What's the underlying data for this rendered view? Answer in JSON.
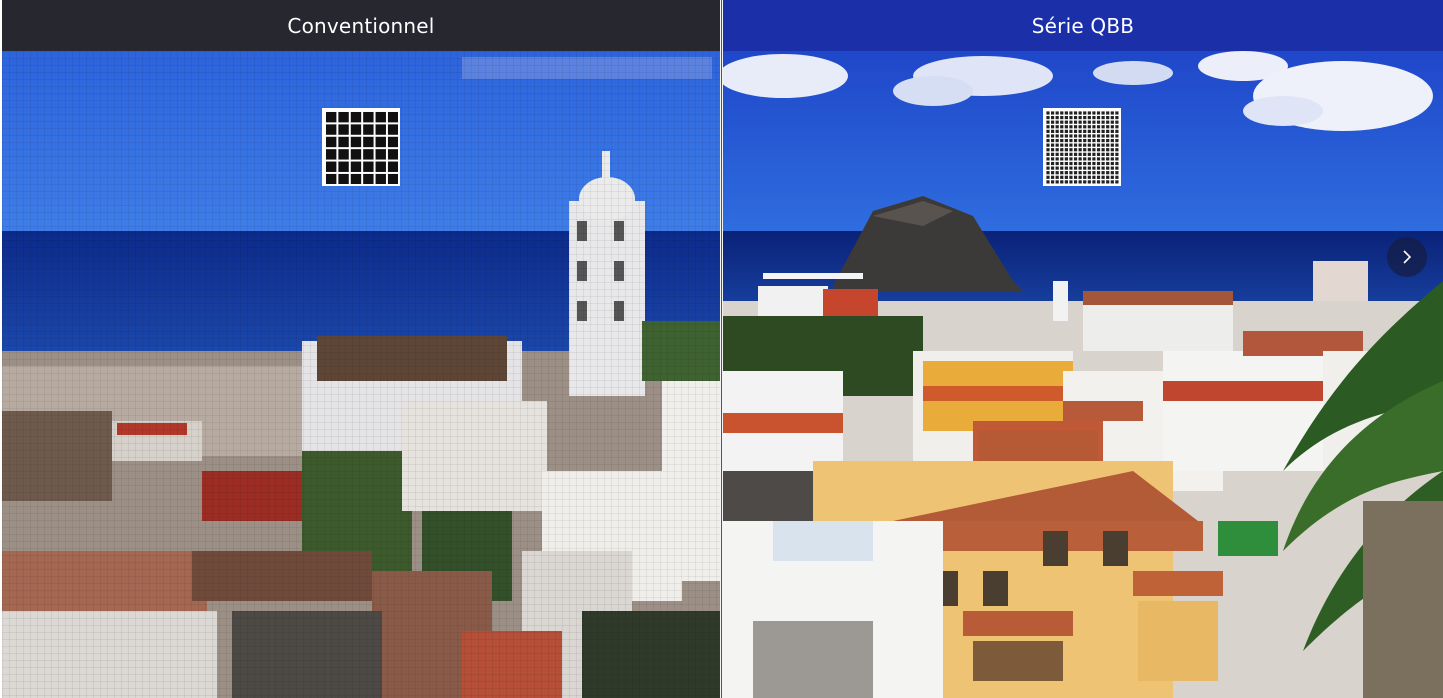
{
  "comparison": {
    "left": {
      "title": "Conventionnel"
    },
    "right": {
      "title": "Série QBB"
    }
  },
  "icons": {
    "left_grid": "coarse-pixel-grid-icon",
    "right_grid": "fine-pixel-grid-icon",
    "next": "chevron-right-icon"
  },
  "colors": {
    "left_header": "#26272f",
    "right_header": "#1b2fa9",
    "text": "#ffffff"
  }
}
